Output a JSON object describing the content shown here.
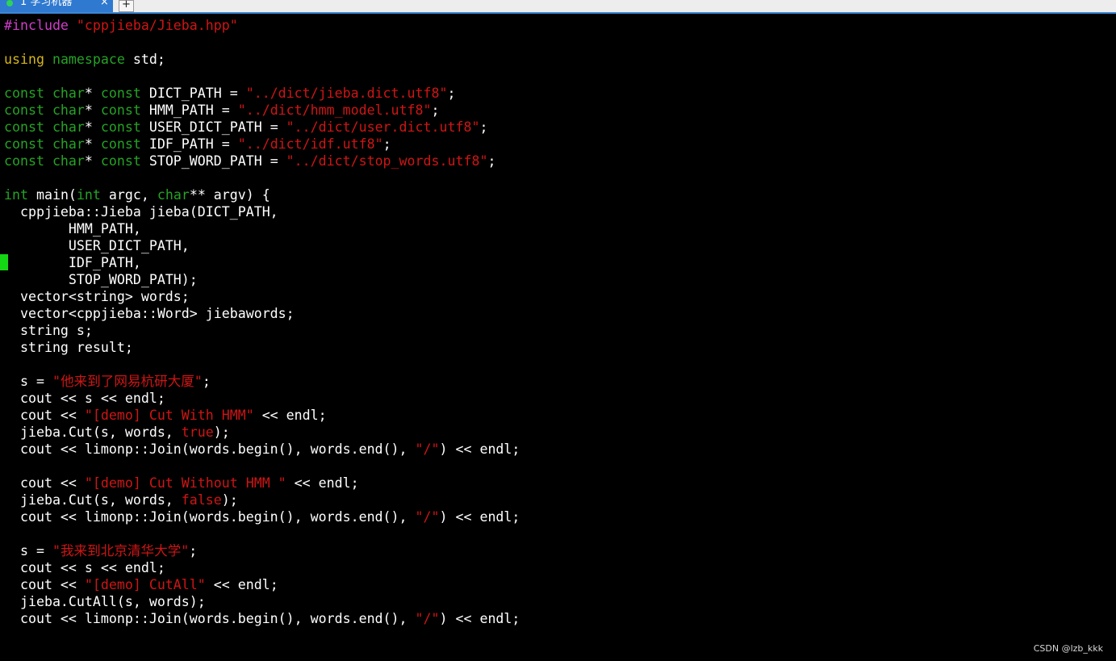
{
  "window": {
    "tab_label": "1 学习机器",
    "tab_close": "×",
    "tab_add": "+"
  },
  "colors": {
    "background": "#000000",
    "preprocessor": "#d03eca",
    "string": "#cf1515",
    "keyword": "#d5b61c",
    "type": "#25a325",
    "text": "#ffffff",
    "cursor": "#15d615",
    "tab_active": "#2f79d0"
  },
  "editor": {
    "lines": [
      [
        {
          "t": "#include ",
          "c": "pre"
        },
        {
          "t": "\"cppjieba/Jieba.hpp\"",
          "c": "str"
        }
      ],
      [],
      [
        {
          "t": "using",
          "c": "kw"
        },
        {
          "t": " ",
          "c": "txt"
        },
        {
          "t": "namespace",
          "c": "type"
        },
        {
          "t": " std;",
          "c": "txt"
        }
      ],
      [],
      [
        {
          "t": "const char",
          "c": "type"
        },
        {
          "t": "* ",
          "c": "txt"
        },
        {
          "t": "const",
          "c": "type"
        },
        {
          "t": " DICT_PATH = ",
          "c": "txt"
        },
        {
          "t": "\"../dict/jieba.dict.utf8\"",
          "c": "str"
        },
        {
          "t": ";",
          "c": "txt"
        }
      ],
      [
        {
          "t": "const char",
          "c": "type"
        },
        {
          "t": "* ",
          "c": "txt"
        },
        {
          "t": "const",
          "c": "type"
        },
        {
          "t": " HMM_PATH = ",
          "c": "txt"
        },
        {
          "t": "\"../dict/hmm_model.utf8\"",
          "c": "str"
        },
        {
          "t": ";",
          "c": "txt"
        }
      ],
      [
        {
          "t": "const char",
          "c": "type"
        },
        {
          "t": "* ",
          "c": "txt"
        },
        {
          "t": "const",
          "c": "type"
        },
        {
          "t": " USER_DICT_PATH = ",
          "c": "txt"
        },
        {
          "t": "\"../dict/user.dict.utf8\"",
          "c": "str"
        },
        {
          "t": ";",
          "c": "txt"
        }
      ],
      [
        {
          "t": "const char",
          "c": "type"
        },
        {
          "t": "* ",
          "c": "txt"
        },
        {
          "t": "const",
          "c": "type"
        },
        {
          "t": " IDF_PATH = ",
          "c": "txt"
        },
        {
          "t": "\"../dict/idf.utf8\"",
          "c": "str"
        },
        {
          "t": ";",
          "c": "txt"
        }
      ],
      [
        {
          "t": "const char",
          "c": "type"
        },
        {
          "t": "* ",
          "c": "txt"
        },
        {
          "t": "const",
          "c": "type"
        },
        {
          "t": " STOP_WORD_PATH = ",
          "c": "txt"
        },
        {
          "t": "\"../dict/stop_words.utf8\"",
          "c": "str"
        },
        {
          "t": ";",
          "c": "txt"
        }
      ],
      [],
      [
        {
          "t": "int",
          "c": "type"
        },
        {
          "t": " main(",
          "c": "txt"
        },
        {
          "t": "int",
          "c": "type"
        },
        {
          "t": " argc, ",
          "c": "txt"
        },
        {
          "t": "char",
          "c": "type"
        },
        {
          "t": "** argv) {",
          "c": "txt"
        }
      ],
      [
        {
          "t": "  cppjieba::Jieba jieba(DICT_PATH,",
          "c": "txt"
        }
      ],
      [
        {
          "t": "        HMM_PATH,",
          "c": "txt"
        }
      ],
      [
        {
          "t": "        USER_DICT_PATH,",
          "c": "txt"
        }
      ],
      [
        {
          "t": "        IDF_PATH,",
          "c": "txt"
        }
      ],
      [
        {
          "t": "        STOP_WORD_PATH);",
          "c": "txt"
        }
      ],
      [
        {
          "t": "  vector<string> words;",
          "c": "txt"
        }
      ],
      [
        {
          "t": "  vector<cppjieba::Word> jiebawords;",
          "c": "txt"
        }
      ],
      [
        {
          "t": "  string s;",
          "c": "txt"
        }
      ],
      [
        {
          "t": "  string result;",
          "c": "txt"
        }
      ],
      [],
      [
        {
          "t": "  s = ",
          "c": "txt"
        },
        {
          "t": "\"他来到了网易杭研大厦\"",
          "c": "str"
        },
        {
          "t": ";",
          "c": "txt"
        }
      ],
      [
        {
          "t": "  cout << s << endl;",
          "c": "txt"
        }
      ],
      [
        {
          "t": "  cout << ",
          "c": "txt"
        },
        {
          "t": "\"[demo] Cut With HMM\"",
          "c": "str"
        },
        {
          "t": " << endl;",
          "c": "txt"
        }
      ],
      [
        {
          "t": "  jieba.Cut(s, words, ",
          "c": "txt"
        },
        {
          "t": "true",
          "c": "str"
        },
        {
          "t": ");",
          "c": "txt"
        }
      ],
      [
        {
          "t": "  cout << limonp::Join(words.begin(), words.end(), ",
          "c": "txt"
        },
        {
          "t": "\"/\"",
          "c": "str"
        },
        {
          "t": ") << endl;",
          "c": "txt"
        }
      ],
      [],
      [
        {
          "t": "  cout << ",
          "c": "txt"
        },
        {
          "t": "\"[demo] Cut Without HMM \"",
          "c": "str"
        },
        {
          "t": " << endl;",
          "c": "txt"
        }
      ],
      [
        {
          "t": "  jieba.Cut(s, words, ",
          "c": "txt"
        },
        {
          "t": "false",
          "c": "str"
        },
        {
          "t": ");",
          "c": "txt"
        }
      ],
      [
        {
          "t": "  cout << limonp::Join(words.begin(), words.end(), ",
          "c": "txt"
        },
        {
          "t": "\"/\"",
          "c": "str"
        },
        {
          "t": ") << endl;",
          "c": "txt"
        }
      ],
      [],
      [
        {
          "t": "  s = ",
          "c": "txt"
        },
        {
          "t": "\"我来到北京清华大学\"",
          "c": "str"
        },
        {
          "t": ";",
          "c": "txt"
        }
      ],
      [
        {
          "t": "  cout << s << endl;",
          "c": "txt"
        }
      ],
      [
        {
          "t": "  cout << ",
          "c": "txt"
        },
        {
          "t": "\"[demo] CutAll\"",
          "c": "str"
        },
        {
          "t": " << endl;",
          "c": "txt"
        }
      ],
      [
        {
          "t": "  jieba.CutAll(s, words);",
          "c": "txt"
        }
      ],
      [
        {
          "t": "  cout << limonp::Join(words.begin(), words.end(), ",
          "c": "txt"
        },
        {
          "t": "\"/\"",
          "c": "str"
        },
        {
          "t": ") << endl;",
          "c": "txt"
        }
      ]
    ]
  },
  "watermark": "CSDN @lzb_kkk"
}
